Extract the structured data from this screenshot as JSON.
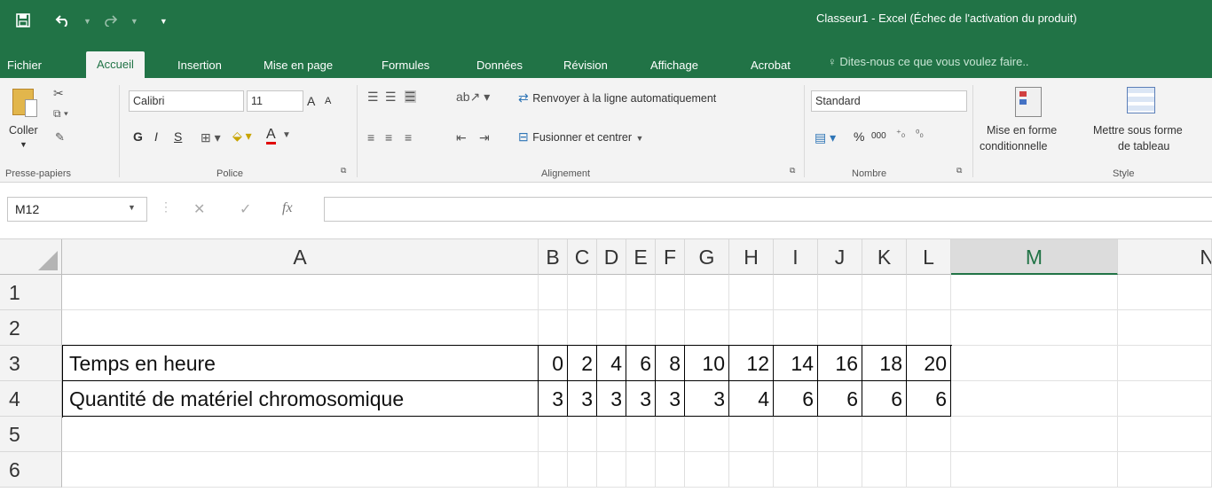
{
  "window": {
    "title": "Classeur1 - Excel (Échec de l'activation du produit)"
  },
  "quick_access": {
    "save_icon": "save-icon",
    "undo_icon": "undo-icon",
    "redo_icon": "redo-icon",
    "customize_icon": "customize-icon"
  },
  "tabs": [
    {
      "label": "Fichier"
    },
    {
      "label": "Accueil"
    },
    {
      "label": "Insertion"
    },
    {
      "label": "Mise en page"
    },
    {
      "label": "Formules"
    },
    {
      "label": "Données"
    },
    {
      "label": "Révision"
    },
    {
      "label": "Affichage"
    },
    {
      "label": "Acrobat"
    }
  ],
  "tell_me": "Dites-nous ce que vous voulez faire..",
  "ribbon": {
    "clipboard": {
      "paste_label": "Coller",
      "group_label": "Presse-papiers"
    },
    "font": {
      "name": "Calibri",
      "size": "11",
      "bold": "G",
      "italic": "I",
      "underline": "S",
      "grow": "A",
      "shrink": "A",
      "color_letter": "A",
      "group_label": "Police"
    },
    "alignment": {
      "wrap": "Renvoyer à la ligne automatiquement",
      "merge": "Fusionner et centrer",
      "group_label": "Alignement"
    },
    "number": {
      "format": "Standard",
      "percent": "%",
      "thousands": "000",
      "group_label": "Nombre"
    },
    "styles": {
      "cond1": "Mise en forme",
      "cond2": "conditionnelle",
      "table1": "Mettre sous forme",
      "table2": "de tableau",
      "group_label": "Style"
    }
  },
  "formula_bar": {
    "name_box": "M12",
    "fx": "fx",
    "value": ""
  },
  "sheet": {
    "columns": [
      "A",
      "B",
      "C",
      "D",
      "E",
      "F",
      "G",
      "H",
      "I",
      "J",
      "K",
      "L",
      "M",
      "N"
    ],
    "rows": [
      "1",
      "2",
      "3",
      "4",
      "5",
      "6"
    ],
    "row3": {
      "label": "Temps en heure",
      "values": [
        "0",
        "2",
        "4",
        "6",
        "8",
        "10",
        "12",
        "14",
        "16",
        "18",
        "20"
      ]
    },
    "row4": {
      "label": "Quantité de matériel chromosomique",
      "values": [
        "3",
        "3",
        "3",
        "3",
        "3",
        "3",
        "4",
        "6",
        "6",
        "6",
        "6"
      ]
    }
  },
  "colors": {
    "excel_green": "#217346",
    "ribbon_bg": "#f3f3f3"
  }
}
